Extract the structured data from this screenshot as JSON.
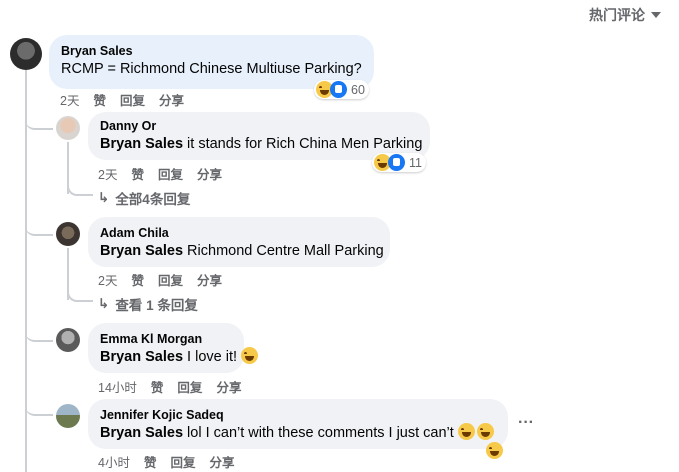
{
  "sort_label": "热门评论",
  "comments": [
    {
      "author": "Bryan Sales",
      "text": "RCMP = Richmond Chinese Multiuse Parking?",
      "time": "2天",
      "like": "赞",
      "reply": "回复",
      "share": "分享",
      "reaction_count": "60"
    },
    {
      "author": "Danny Or",
      "mention": "Bryan Sales",
      "text": " it stands for Rich China Men Parking",
      "time": "2天",
      "like": "赞",
      "reply": "回复",
      "share": "分享",
      "reaction_count": "11",
      "view_replies": "全部4条回复"
    },
    {
      "author": "Adam Chila",
      "mention": "Bryan Sales",
      "text": " Richmond Centre Mall Parking",
      "time": "2天",
      "like": "赞",
      "reply": "回复",
      "share": "分享",
      "view_replies": "查看 1 条回复"
    },
    {
      "author": "Emma Kl Morgan",
      "mention": "Bryan Sales",
      "text": " I love it!",
      "time": "14小时",
      "like": "赞",
      "reply": "回复",
      "share": "分享"
    },
    {
      "author": "Jennifer Kojic Sadeq",
      "mention": "Bryan Sales",
      "text": " lol I can’t with these comments I just can’t",
      "time": "4小时",
      "like": "赞",
      "reply": "回复",
      "share": "分享",
      "more": "···"
    }
  ],
  "colors": {
    "bubble": "#f0f2f5",
    "secondary_text": "#65676b",
    "like_blue": "#1877f2",
    "haha_yellow": "#f7c948"
  }
}
